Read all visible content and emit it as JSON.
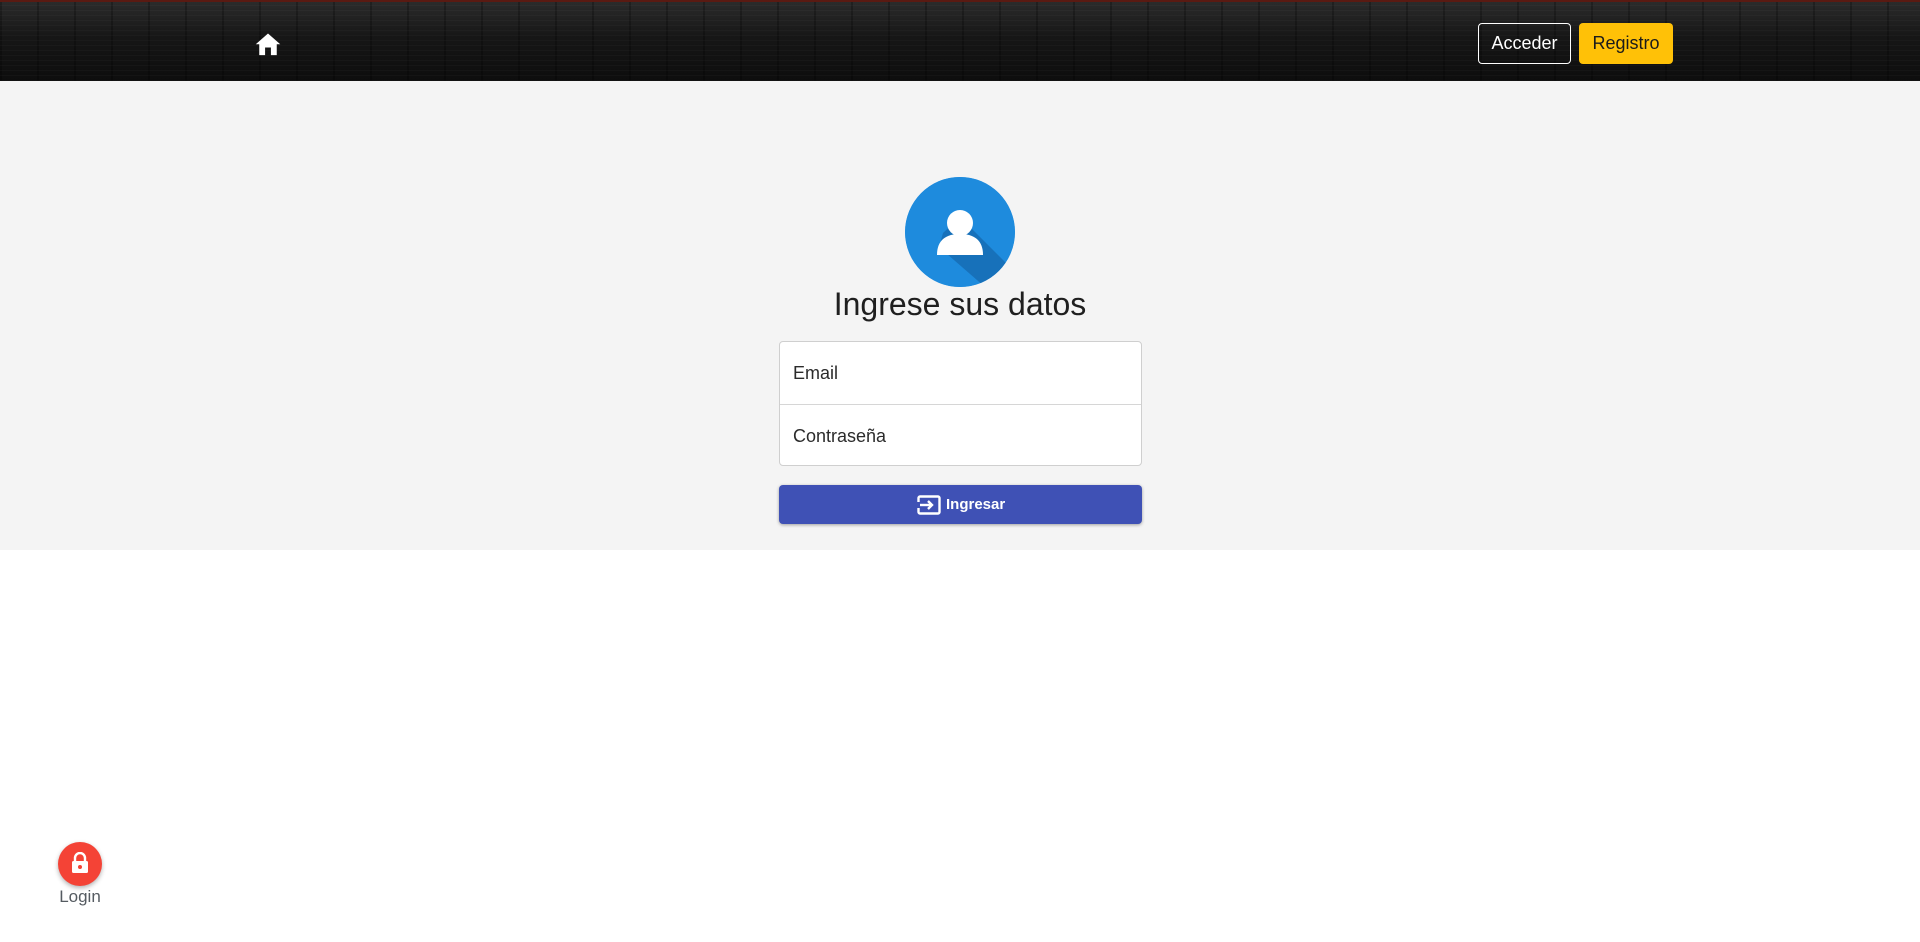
{
  "navbar": {
    "home_icon": "home-icon",
    "acceder_label": "Acceder",
    "registro_label": "Registro",
    "registro_color": "#ffc107"
  },
  "login_form": {
    "avatar_icon": "user-avatar-icon",
    "avatar_color": "#1e8bdd",
    "title": "Ingrese sus datos",
    "email_placeholder": "Email",
    "password_placeholder": "Contraseña",
    "submit_icon": "login-enter-icon",
    "submit_label": "Ingresar",
    "submit_color": "#3f51b5"
  },
  "fab": {
    "icon": "lock-icon",
    "label": "Login",
    "color": "#f44336"
  }
}
